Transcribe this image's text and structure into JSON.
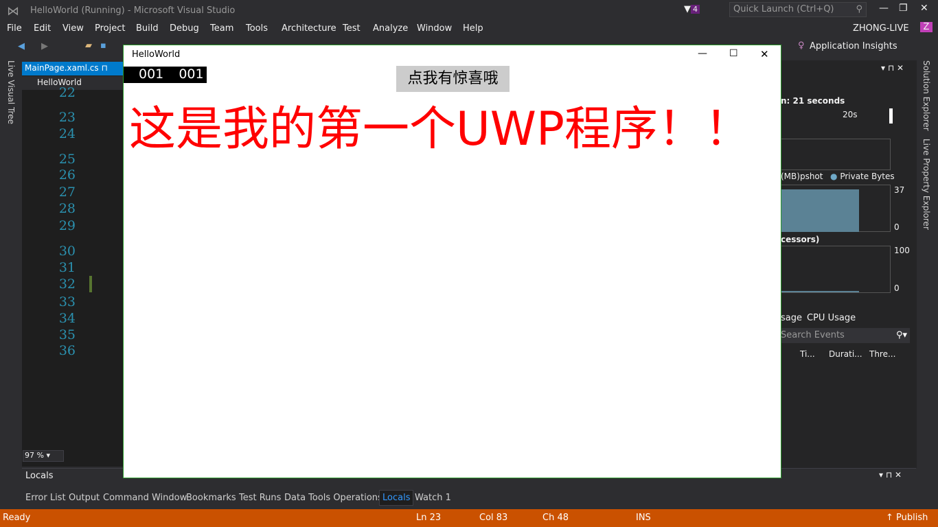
{
  "window": {
    "title": "HelloWorld (Running) - Microsoft Visual Studio",
    "quick_launch": "Quick Launch (Ctrl+Q)",
    "notifications": "4",
    "user": "ZHONG-LIVE",
    "avatar": "Z"
  },
  "menu": [
    "File",
    "Edit",
    "View",
    "Project",
    "Build",
    "Debug",
    "Team",
    "Tools",
    "Architecture",
    "Test",
    "Analyze",
    "Window",
    "Help"
  ],
  "toolbar": {
    "app_insights": "Application Insights"
  },
  "left_strip": "Live Visual Tree",
  "editor": {
    "tab": "MainPage.xaml.cs",
    "nav": "HelloWorld",
    "line_numbers": [
      "22",
      "23",
      "24",
      "25",
      "26",
      "27",
      "28",
      "29",
      "30",
      "31",
      "32",
      "33",
      "34",
      "35",
      "36"
    ],
    "zoom": "97 %"
  },
  "app": {
    "title": "HelloWorld",
    "counter_a": "001",
    "counter_b": "001",
    "button": "点我有惊喜哦",
    "headline": "这是我的第一个UWP程序！！"
  },
  "diagnostics": {
    "session": "n: 21 seconds",
    "tick": "20s",
    "memory_legend": "(MB)pshot",
    "private_bytes": "Private Bytes",
    "mem_max": "37",
    "mem_min": "0",
    "cpu_title": "cessors)",
    "cpu_max": "100",
    "cpu_min": "0",
    "tab_memory": "sage",
    "tab_cpu": "CPU Usage",
    "search": "Search Events",
    "cols": [
      "Ti...",
      "Durati...",
      "Thre..."
    ]
  },
  "right_strip": [
    "Solution Explorer",
    "Live Property Explorer"
  ],
  "locals": {
    "title": "Locals"
  },
  "bottom_tabs": [
    "Error List",
    "Output",
    "Command Window",
    "Bookmarks",
    "Test Runs",
    "Data Tools Operations",
    "Locals",
    "Watch 1"
  ],
  "status": {
    "ready": "Ready",
    "ln": "Ln 23",
    "col": "Col 83",
    "ch": "Ch 48",
    "ins": "INS",
    "publish": "Publish"
  },
  "colors": {
    "accent": "#007acc",
    "status": "#ca5100",
    "headline": "#ff0000"
  }
}
